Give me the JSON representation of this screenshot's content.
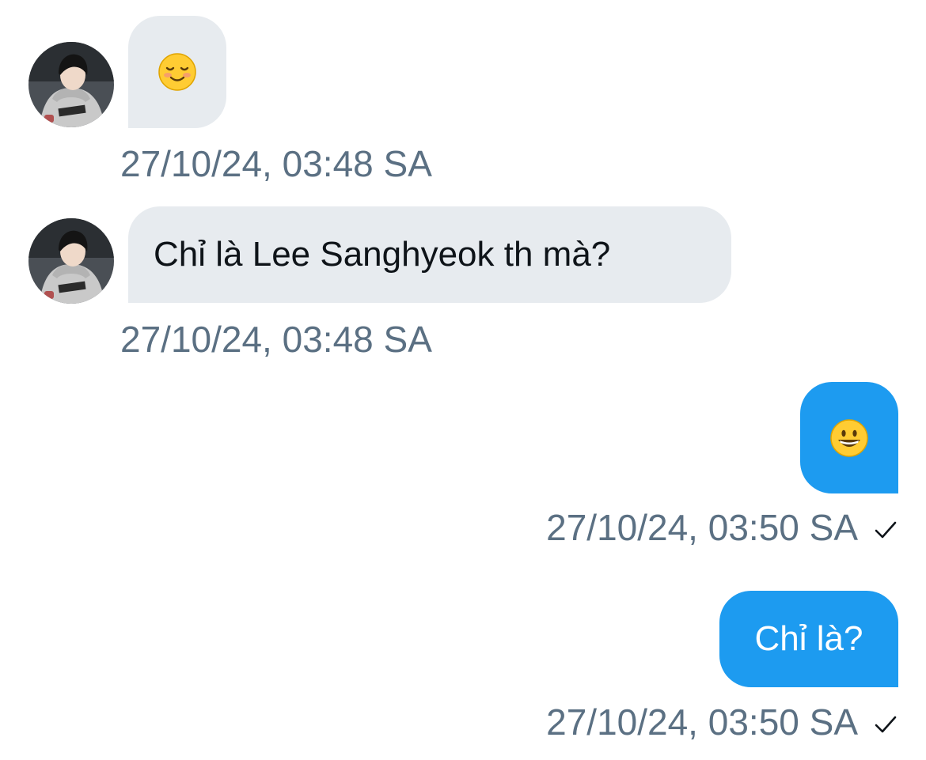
{
  "messages": [
    {
      "direction": "incoming",
      "content": "☺️",
      "timestamp": "27/10/24, 03:48 SA"
    },
    {
      "direction": "incoming",
      "content": "Chỉ là Lee Sanghyeok th mà?",
      "timestamp": "27/10/24, 03:48 SA"
    },
    {
      "direction": "outgoing",
      "content": "😀",
      "timestamp": "27/10/24, 03:50 SA",
      "status_icon": "check-icon"
    },
    {
      "direction": "outgoing",
      "content": "Chỉ là?",
      "timestamp": "27/10/24, 03:50 SA",
      "status_icon": "check-icon"
    }
  ],
  "colors": {
    "incoming_bubble": "#e7ebef",
    "outgoing_bubble": "#1d9bf0",
    "timestamp_text": "#5b7083",
    "incoming_text": "#0f1419",
    "outgoing_text": "#ffffff"
  }
}
